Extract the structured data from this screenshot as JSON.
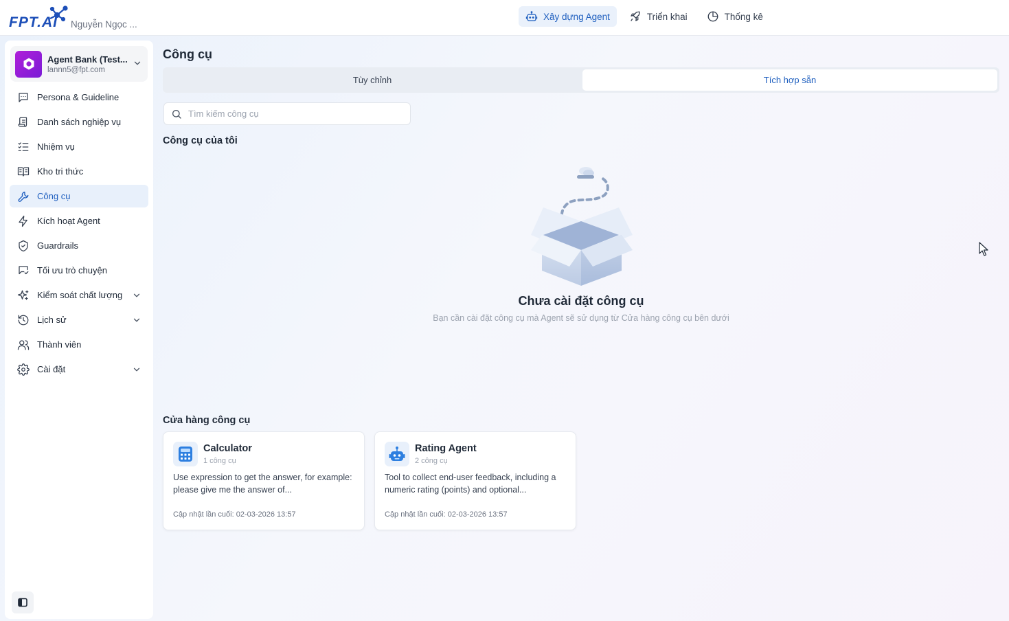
{
  "header": {
    "brand": "FPT.AI",
    "user_name": "Nguyễn Ngọc ...",
    "nav": [
      {
        "label": "Xây dựng Agent",
        "icon": "robot-icon",
        "active": true
      },
      {
        "label": "Triển khai",
        "icon": "rocket-icon",
        "active": false
      },
      {
        "label": "Thống kê",
        "icon": "pie-chart-icon",
        "active": false
      }
    ]
  },
  "sidebar": {
    "agent": {
      "name": "Agent Bank (Test...",
      "email": "lannn5@fpt.com"
    },
    "items": [
      {
        "label": "Persona & Guideline",
        "icon": "chat-bubble-icon"
      },
      {
        "label": "Danh sách nghiệp vụ",
        "icon": "scroll-icon"
      },
      {
        "label": "Nhiệm vụ",
        "icon": "checklist-icon"
      },
      {
        "label": "Kho tri thức",
        "icon": "book-icon"
      },
      {
        "label": "Công cụ",
        "icon": "wrench-icon",
        "active": true
      },
      {
        "label": "Kích hoạt Agent",
        "icon": "lightning-icon"
      },
      {
        "label": "Guardrails",
        "icon": "shield-icon"
      },
      {
        "label": "Tối ưu trò chuyện",
        "icon": "chat-optimize-icon"
      },
      {
        "label": "Kiểm soát chất lượng",
        "icon": "sparkle-icon",
        "expandable": true
      },
      {
        "label": "Lịch sử",
        "icon": "history-icon",
        "expandable": true
      },
      {
        "label": "Thành viên",
        "icon": "users-icon"
      },
      {
        "label": "Cài đặt",
        "icon": "gear-icon",
        "expandable": true
      }
    ]
  },
  "main": {
    "title": "Công cụ",
    "tabs": [
      {
        "label": "Tùy chỉnh",
        "active": false
      },
      {
        "label": "Tích hợp sẵn",
        "active": true
      }
    ],
    "search": {
      "placeholder": "Tìm kiếm công cụ",
      "value": ""
    },
    "my_tools": {
      "title": "Công cụ của tôi",
      "empty_title": "Chưa cài đặt công cụ",
      "empty_desc": "Bạn cần cài đặt công cụ mà Agent sẽ sử dụng từ Cửa hàng công cụ bên dưới"
    },
    "store": {
      "title": "Cửa hàng công cụ",
      "cards": [
        {
          "name": "Calculator",
          "count": "1 công cụ",
          "desc": "Use expression to get the answer, for example: please give me the answer of...",
          "updated": "Cập nhật lần cuối: 02-03-2026 13:57",
          "icon": "calculator-icon"
        },
        {
          "name": "Rating Agent",
          "count": "2 công cụ",
          "desc": "Tool to collect end-user feedback, including a numeric rating (points) and optional...",
          "updated": "Cập nhật lần cuối: 02-03-2026 13:57",
          "icon": "robot-icon"
        }
      ]
    }
  },
  "colors": {
    "accent": "#1f5fbf",
    "brand_blue": "#1d4fb8",
    "avatar_purple": "#9b1fd8"
  }
}
